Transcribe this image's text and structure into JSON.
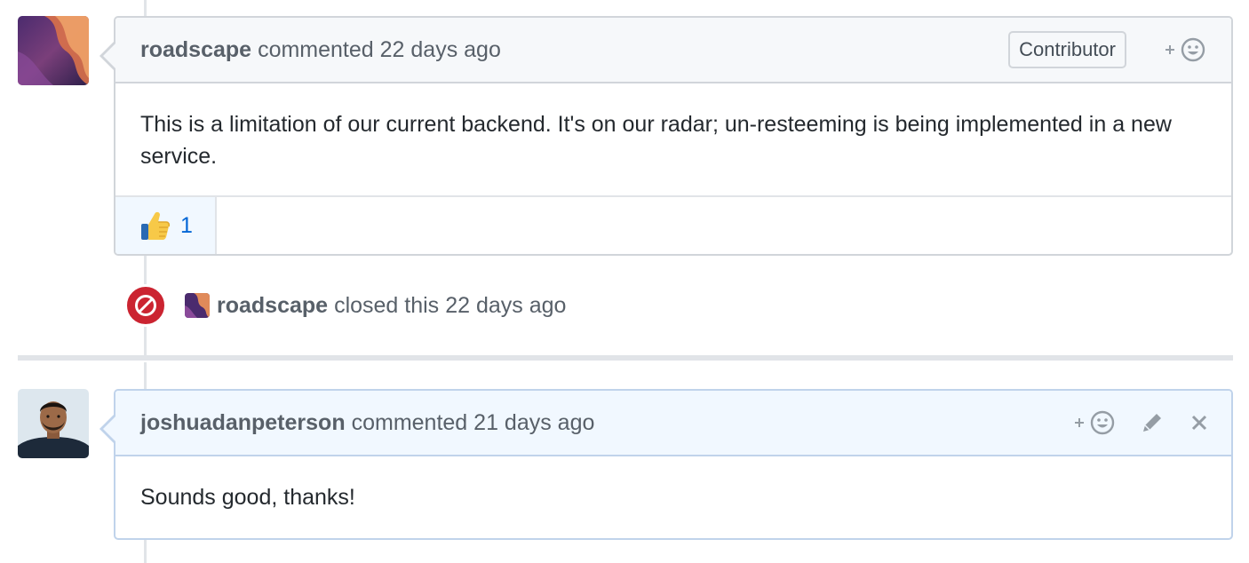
{
  "comments": [
    {
      "author": "roadscape",
      "action": "commented",
      "time": "22 days ago",
      "badge": "Contributor",
      "body": "This is a limitation of our current backend. It's on our radar; un-resteeming is being implemented in a new service.",
      "reactions": [
        {
          "icon": "thumbs-up-icon",
          "count": "1"
        }
      ]
    },
    {
      "author": "joshuadanpeterson",
      "action": "commented",
      "time": "21 days ago",
      "body": "Sounds good, thanks!"
    }
  ],
  "event": {
    "icon": "circle-slash-icon",
    "author": "roadscape",
    "action": "closed this",
    "time": "22 days ago"
  },
  "icons": {
    "add_reaction": "smiley-plus-icon",
    "edit": "pencil-icon",
    "delete": "close-icon"
  },
  "colors": {
    "closed_red": "#cb2431",
    "link_blue": "#0366d6",
    "own_comment_bg": "#f1f8ff"
  }
}
